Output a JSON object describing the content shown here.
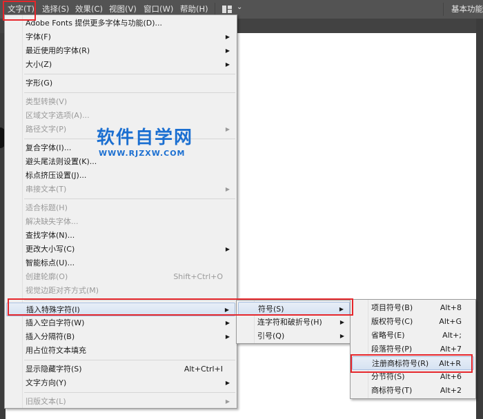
{
  "menubar": {
    "items": [
      "文字(T)",
      "选择(S)",
      "效果(C)",
      "视图(V)",
      "窗口(W)",
      "帮助(H)"
    ],
    "workspace": "基本功能"
  },
  "watermark": {
    "title": "软件自学网",
    "url": "WWW.RJZXW.COM"
  },
  "main_menu": [
    {
      "label": "Adobe Fonts 提供更多字体与功能(D)..."
    },
    {
      "label": "字体(F)",
      "submenu": true
    },
    {
      "label": "最近使用的字体(R)",
      "submenu": true
    },
    {
      "label": "大小(Z)",
      "submenu": true
    },
    {
      "sep": true
    },
    {
      "label": "字形(G)"
    },
    {
      "sep": true
    },
    {
      "label": "类型转换(V)",
      "disabled": true
    },
    {
      "label": "区域文字选项(A)...",
      "disabled": true
    },
    {
      "label": "路径文字(P)",
      "disabled": true,
      "submenu": true
    },
    {
      "sep": true
    },
    {
      "label": "复合字体(I)..."
    },
    {
      "label": "避头尾法则设置(K)..."
    },
    {
      "label": "标点挤压设置(J)..."
    },
    {
      "label": "串接文本(T)",
      "disabled": true,
      "submenu": true
    },
    {
      "sep": true
    },
    {
      "label": "适合标题(H)",
      "disabled": true
    },
    {
      "label": "解决缺失字体...",
      "disabled": true
    },
    {
      "label": "查找字体(N)..."
    },
    {
      "label": "更改大小写(C)",
      "submenu": true
    },
    {
      "label": "智能标点(U)..."
    },
    {
      "label": "创建轮廓(O)",
      "disabled": true,
      "shortcut": "Shift+Ctrl+O"
    },
    {
      "label": "视觉边距对齐方式(M)",
      "disabled": true
    },
    {
      "sep": true
    },
    {
      "label": "插入特殊字符(I)",
      "submenu": true,
      "highlighted": true
    },
    {
      "label": "插入空白字符(W)",
      "submenu": true
    },
    {
      "label": "插入分隔符(B)",
      "submenu": true
    },
    {
      "label": "用占位符文本填充"
    },
    {
      "sep": true
    },
    {
      "label": "显示隐藏字符(S)",
      "shortcut": "Alt+Ctrl+I"
    },
    {
      "label": "文字方向(Y)",
      "submenu": true
    },
    {
      "sep": true
    },
    {
      "label": "旧版文本(L)",
      "disabled": true,
      "submenu": true
    }
  ],
  "sub_menu": [
    {
      "label": "符号(S)",
      "submenu": true,
      "highlighted": true
    },
    {
      "label": "连字符和破折号(H)",
      "submenu": true
    },
    {
      "label": "引号(Q)",
      "submenu": true
    }
  ],
  "symbol_menu": [
    {
      "label": "项目符号(B)",
      "shortcut": "Alt+8"
    },
    {
      "label": "版权符号(C)",
      "shortcut": "Alt+G"
    },
    {
      "label": "省略号(E)",
      "shortcut": "Alt+;"
    },
    {
      "label": "段落符号(P)",
      "shortcut": "Alt+7"
    },
    {
      "label": "注册商标符号(R)",
      "shortcut": "Alt+R",
      "highlighted": true
    },
    {
      "label": "分节符(S)",
      "shortcut": "Alt+6"
    },
    {
      "label": "商标符号(T)",
      "shortcut": "Alt+2"
    }
  ]
}
